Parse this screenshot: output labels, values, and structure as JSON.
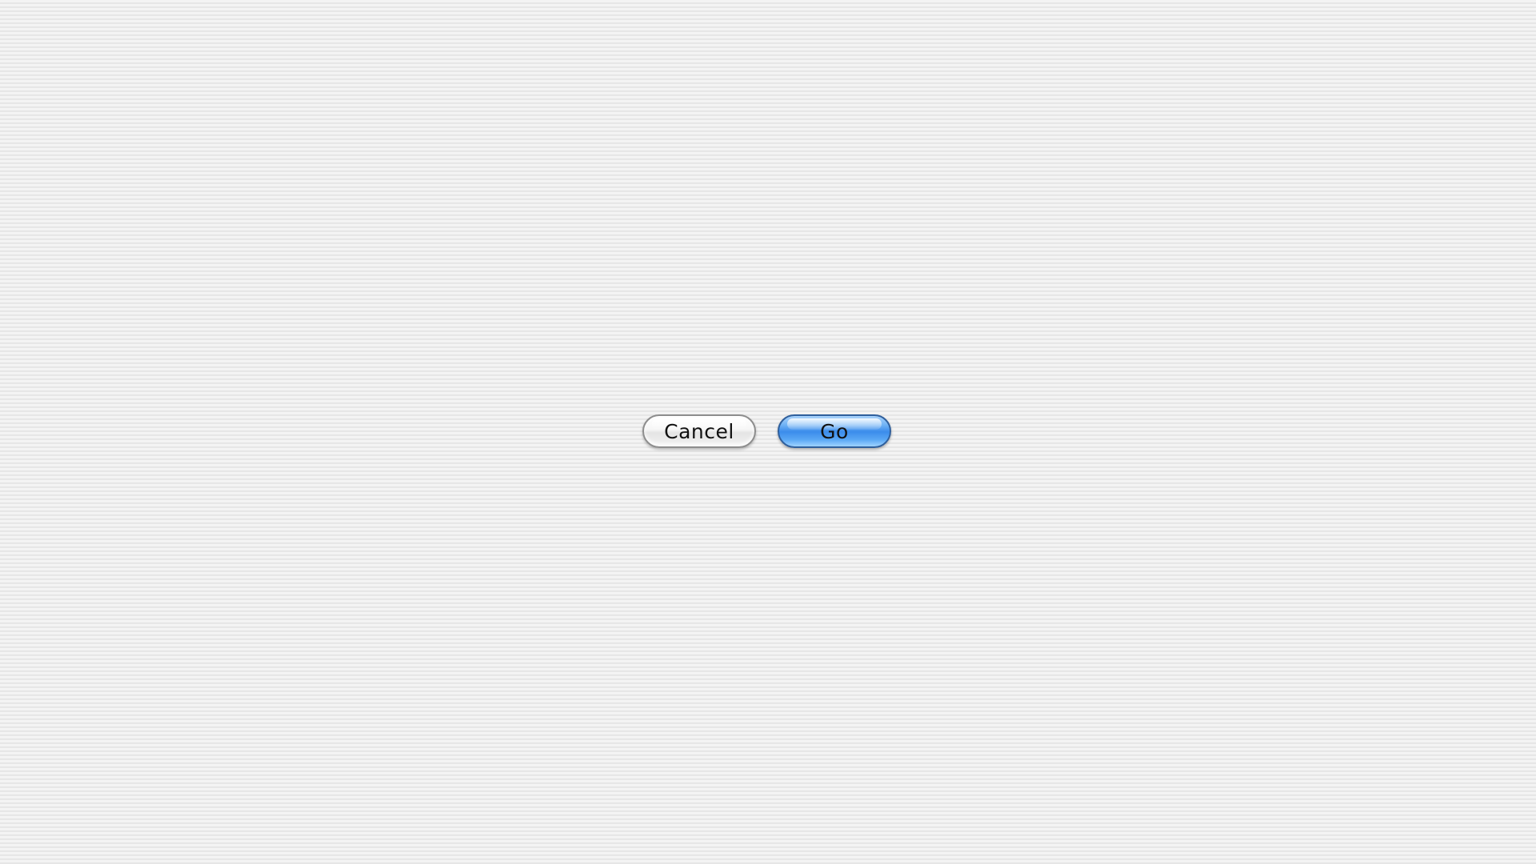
{
  "dialog": {
    "buttons": {
      "cancel_label": "Cancel",
      "go_label": "Go"
    },
    "colors": {
      "primary_button": "#3b8ceb",
      "secondary_button": "#f6f6f6",
      "background_stripe_light": "#f3f3f3",
      "background_stripe_dark": "#e6e6e6"
    }
  }
}
